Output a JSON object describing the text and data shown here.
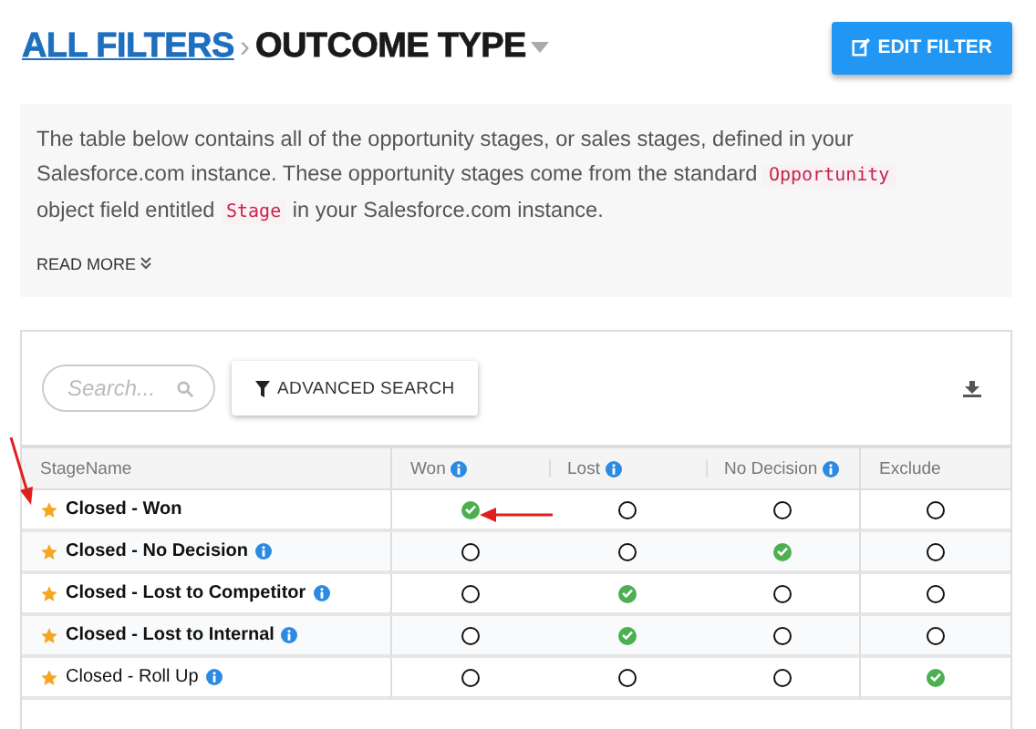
{
  "breadcrumb": {
    "link": "ALL FILTERS",
    "separator": "›",
    "current": "OUTCOME TYPE"
  },
  "edit_button": "EDIT FILTER",
  "description": {
    "parts": [
      {
        "kind": "text",
        "text": "The table below contains all of the opportunity stages, or sales stages, defined in your Salesforce.com instance. These opportunity stages come from the standard "
      },
      {
        "kind": "code",
        "text": "Opportunity"
      },
      {
        "kind": "text",
        "text": " object field entitled "
      },
      {
        "kind": "code",
        "text": "Stage"
      },
      {
        "kind": "text",
        "text": " in your Salesforce.com instance."
      }
    ],
    "read_more": "READ MORE"
  },
  "search": {
    "placeholder": "Search..."
  },
  "advanced_search": "ADVANCED SEARCH",
  "table": {
    "columns": [
      {
        "label": "StageName",
        "info": false
      },
      {
        "label": "Won",
        "info": true
      },
      {
        "label": "Lost",
        "info": true
      },
      {
        "label": "No Decision",
        "info": true
      },
      {
        "label": "Exclude",
        "info": false
      }
    ],
    "rows": [
      {
        "name": "Closed - Won",
        "bold": true,
        "info": false,
        "options": [
          {
            "selected": true
          },
          {
            "selected": false
          },
          {
            "selected": false
          },
          {
            "selected": false
          }
        ]
      },
      {
        "name": "Closed - No Decision",
        "bold": true,
        "info": true,
        "options": [
          {
            "selected": false
          },
          {
            "selected": false
          },
          {
            "selected": true
          },
          {
            "selected": false
          }
        ]
      },
      {
        "name": "Closed - Lost to Competitor",
        "bold": true,
        "info": true,
        "options": [
          {
            "selected": false
          },
          {
            "selected": true
          },
          {
            "selected": false
          },
          {
            "selected": false
          }
        ]
      },
      {
        "name": "Closed - Lost to Internal",
        "bold": true,
        "info": true,
        "options": [
          {
            "selected": false
          },
          {
            "selected": true
          },
          {
            "selected": false
          },
          {
            "selected": false
          }
        ]
      },
      {
        "name": "Closed - Roll Up",
        "bold": false,
        "info": true,
        "options": [
          {
            "selected": false
          },
          {
            "selected": false
          },
          {
            "selected": false
          },
          {
            "selected": true
          }
        ]
      }
    ]
  }
}
